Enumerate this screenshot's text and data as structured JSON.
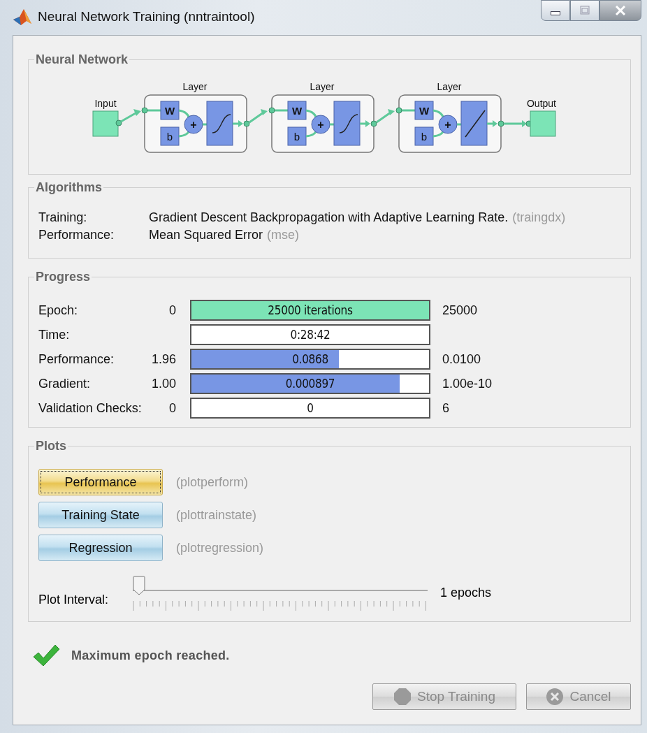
{
  "window": {
    "title": "Neural Network Training (nntraintool)",
    "controls": [
      {
        "kind": "minimize"
      },
      {
        "kind": "maximize"
      },
      {
        "kind": "close"
      }
    ]
  },
  "network": {
    "title": "Neural Network",
    "input_label": "Input",
    "output_label": "Output",
    "layers": [
      {
        "label": "Layer",
        "weight": "W",
        "bias": "b",
        "sum": "+",
        "kind": "sigmoid"
      },
      {
        "label": "Layer",
        "weight": "W",
        "bias": "b",
        "sum": "+",
        "kind": "sigmoid"
      },
      {
        "label": "Layer",
        "weight": "W",
        "bias": "b",
        "sum": "+",
        "kind": "linear"
      }
    ]
  },
  "algorithms": {
    "title": "Algorithms",
    "rows": [
      {
        "label": "Training:",
        "value": "Gradient Descent Backpropagation with Adaptive Learning Rate.",
        "code": "(traingdx)"
      },
      {
        "label": "Performance:",
        "value": "Mean Squared Error",
        "code": "(mse)"
      }
    ]
  },
  "progress": {
    "title": "Progress",
    "rows": [
      {
        "label": "Epoch:",
        "start": "0",
        "bar_text": "25000 iterations",
        "level": 1,
        "color": "#7ce4b6",
        "end": "25000"
      },
      {
        "label": "Time:",
        "bar_text": "0:28:42"
      },
      {
        "label": "Performance:",
        "start": "1.96",
        "bar_text": "0.0868",
        "level": 0.62,
        "color": "#7896e4",
        "end": "0.0100"
      },
      {
        "label": "Gradient:",
        "start": "1.00",
        "bar_text": "0.000897",
        "level": 0.875,
        "color": "#7896e4",
        "end": "1.00e-10"
      },
      {
        "label": "Validation Checks:",
        "start": "0",
        "bar_text": "0",
        "end": "6"
      }
    ]
  },
  "plots": {
    "title": "Plots",
    "buttons": [
      {
        "label": "Performance",
        "focused": true,
        "code": "(plotperform)"
      },
      {
        "label": "Training State",
        "focused": false,
        "code": "(plottrainstate)"
      },
      {
        "label": "Regression",
        "focused": false,
        "code": "(plotregression)"
      }
    ],
    "interval": {
      "label": "Plot Interval:",
      "level": 0,
      "value": "1 epochs"
    }
  },
  "status": {
    "text": "Maximum epoch reached."
  },
  "buttons": [
    {
      "label": "Stop Training",
      "kind": "stop",
      "disabled": true
    },
    {
      "label": "Cancel",
      "kind": "cancel",
      "disabled": true
    }
  ]
}
